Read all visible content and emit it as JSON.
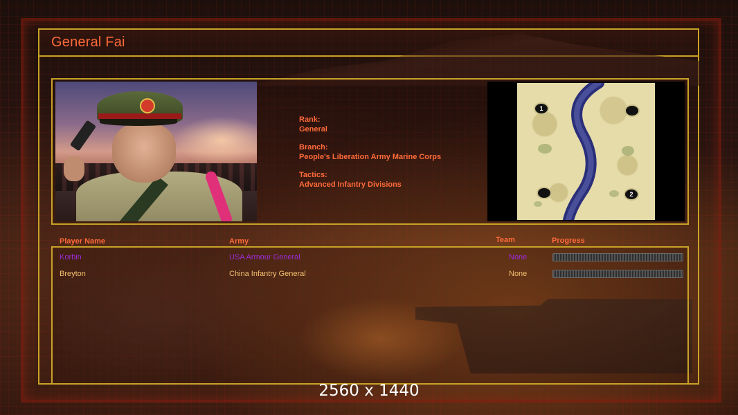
{
  "window": {
    "title": "General Fai"
  },
  "general": {
    "rank_label": "Rank:",
    "rank": "General",
    "branch_label": "Branch:",
    "branch": "People's Liberation Army Marine Corps",
    "tactics_label": "Tactics:",
    "tactics": "Advanced Infantry Divisions"
  },
  "map": {
    "start_positions": [
      "1",
      "2"
    ]
  },
  "players_table": {
    "headers": {
      "name": "Player Name",
      "army": "Army",
      "team": "Team",
      "progress": "Progress"
    },
    "rows": [
      {
        "name": "Korbin",
        "army": "USA Armour General",
        "team": "None",
        "color": "#9b2bd6",
        "progress": 0
      },
      {
        "name": "Breyton",
        "army": "China Infantry General",
        "team": "None",
        "color": "#f0c070",
        "progress": 0
      }
    ]
  },
  "overlay": {
    "resolution": "2560 x 1440"
  },
  "colors": {
    "accent": "#ff6a3a",
    "frame": "#c9a227"
  }
}
